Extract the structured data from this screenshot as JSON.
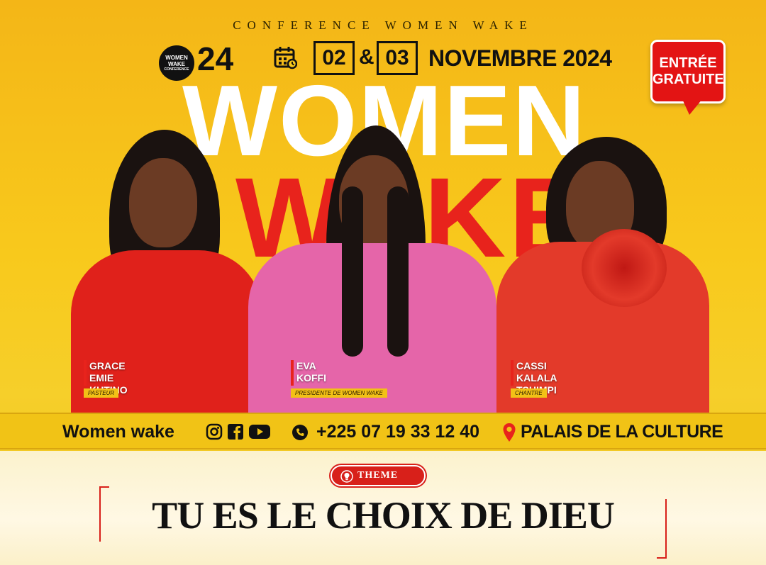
{
  "header": {
    "tagline": "CONFERENCE WOMEN WAKE",
    "logo_text": [
      "WOMEN",
      "WAKE",
      "CONFERENCE"
    ],
    "edition": "24",
    "date_day_1": "02",
    "date_amp": "&",
    "date_day_2": "03",
    "date_month_year": "NOVEMBRE 2024",
    "free_entry": [
      "ENTRÉE",
      "GRATUITE"
    ]
  },
  "title": {
    "line1": "WOMEN",
    "line2": "WAKE"
  },
  "speakers": [
    {
      "name_line1": "GRACE EMIE",
      "name_line2": "KUTINO",
      "role": "PASTEUR",
      "outfit_color": "#e0211b"
    },
    {
      "name_line1": "EVA",
      "name_line2": "KOFFI",
      "role": "PRESIDENTE DE WOMEN WAKE",
      "outfit_color": "#e565a9"
    },
    {
      "name_line1": "CASSI KALALA",
      "name_line2": "TSHIMPI",
      "role": "CHANTRE",
      "outfit_color": "#e33a2a"
    }
  ],
  "contact": {
    "brand": "Women wake",
    "social_icons": [
      "instagram-icon",
      "facebook-icon",
      "youtube-icon"
    ],
    "phone": "+225 07 19 33 12 40",
    "venue": "PALAIS DE LA CULTURE"
  },
  "theme": {
    "label": "THEME",
    "title": "TU ES LE CHOIX DE DIEU"
  },
  "colors": {
    "yellow": "#f8c91c",
    "red": "#e8231c",
    "dark": "#111111"
  }
}
